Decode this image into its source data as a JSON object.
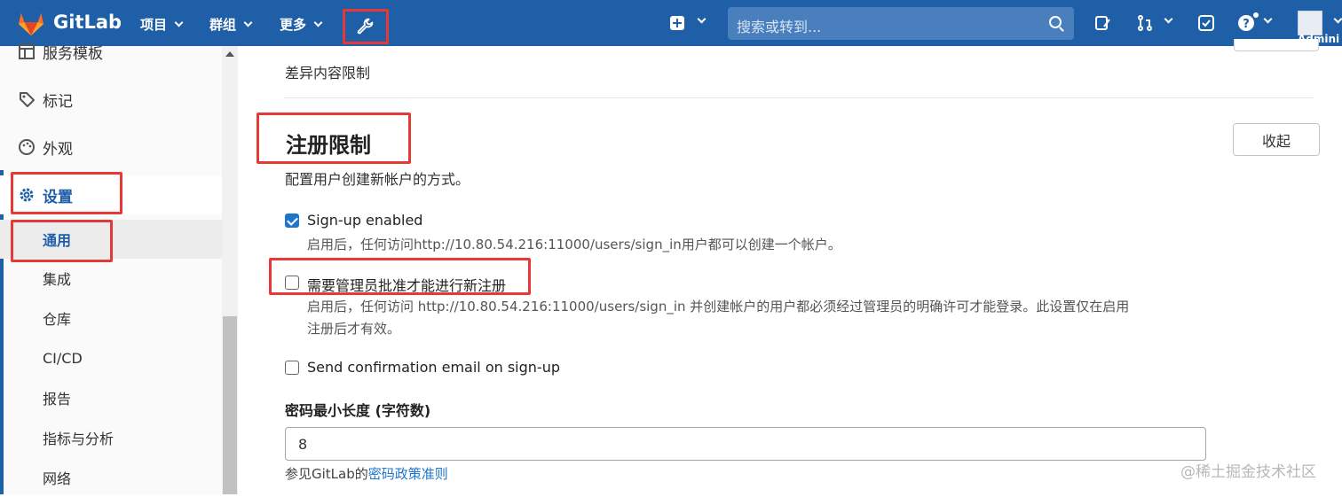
{
  "topbar": {
    "brand": "GitLab",
    "nav": [
      "项目",
      "群组",
      "更多"
    ],
    "search_placeholder": "搜索或转到...",
    "user_label": "Admini"
  },
  "sidebar": {
    "items": [
      {
        "label": "服务模板",
        "icon": "template-icon"
      },
      {
        "label": "标记",
        "icon": "label-icon"
      },
      {
        "label": "外观",
        "icon": "appearance-icon"
      },
      {
        "label": "设置",
        "icon": "gear-icon"
      }
    ],
    "sub_items": [
      "通用",
      "集成",
      "仓库",
      "CI/CD",
      "报告",
      "指标与分析",
      "网络"
    ]
  },
  "main": {
    "prev_section": "差异内容限制",
    "section_title": "注册限制",
    "section_desc": "配置用户创建新帐户的方式。",
    "collapse_label": "收起",
    "options": [
      {
        "label": "Sign-up enabled",
        "checked": true,
        "help": "启用后，任何访问http://10.80.54.216:11000/users/sign_in用户都可以创建一个帐户。"
      },
      {
        "label": "需要管理员批准才能进行新注册",
        "checked": false,
        "help_line1": "启用后，任何访问 http://10.80.54.216:11000/users/sign_in 并创建帐户的用户都必须经过管理员的明确许可才能登录。此设置仅在启用",
        "help_line2": "注册后才有效。"
      },
      {
        "label": "Send confirmation email on sign-up",
        "checked": false
      }
    ],
    "password_label": "密码最小长度 (字符数)",
    "password_value": "8",
    "password_help_prefix": "参见GitLab的",
    "password_help_link": "密码政策准则"
  },
  "watermark": "@稀土掘金技术社区",
  "colors": {
    "nav_bg": "#1f5fa8",
    "accent": "#1f75cb",
    "highlight": "#e53935"
  }
}
